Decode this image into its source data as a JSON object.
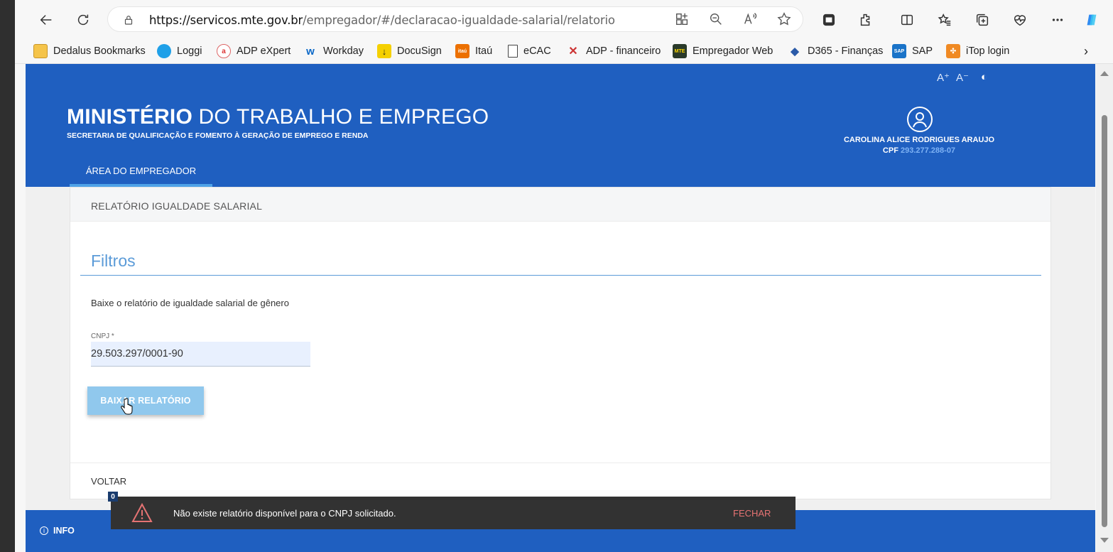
{
  "browser": {
    "url_host": "https://servicos.mte.gov.br",
    "url_path": "/empregador/#/declaracao-igualdade-salarial/relatorio",
    "bookmarks": [
      {
        "label": "Dedalus Bookmarks",
        "icon": "folder-icon"
      },
      {
        "label": "Loggi",
        "icon": "loggi-icon"
      },
      {
        "label": "ADP eXpert",
        "icon": "adp-icon"
      },
      {
        "label": "Workday",
        "icon": "workday-icon"
      },
      {
        "label": "DocuSign",
        "icon": "docusign-icon"
      },
      {
        "label": "Itaú",
        "icon": "itau-icon"
      },
      {
        "label": "eCAC",
        "icon": "page-icon"
      },
      {
        "label": "ADP - financeiro",
        "icon": "adp-x-icon"
      },
      {
        "label": "Empregador Web",
        "icon": "mte-icon"
      },
      {
        "label": "D365 - Finanças",
        "icon": "d365-icon"
      },
      {
        "label": "SAP",
        "icon": "sap-icon"
      },
      {
        "label": "iTop login",
        "icon": "itop-icon"
      }
    ]
  },
  "header": {
    "brand_bold": "MINISTÉRIO",
    "brand_rest": " DO TRABALHO E EMPREGO",
    "subtitle": "SECRETARIA DE QUALIFICAÇÃO E FOMENTO À GERAÇÃO DE EMPREGO E RENDA",
    "a11y": {
      "increase": "A⁺",
      "decrease": "A⁻",
      "contrast": "◐"
    },
    "user_name": "CAROLINA ALICE RODRIGUES ARAUJO",
    "cpf_label": "CPF ",
    "cpf_value": "293.277.288-07",
    "nav_tab": "ÁREA DO EMPREGADOR"
  },
  "card": {
    "title": "RELATÓRIO IGUALDADE SALARIAL",
    "section_title": "Filtros",
    "description": "Baixe o relatório de igualdade salarial de gênero",
    "cnpj_label": "CNPJ *",
    "cnpj_value": "29.503.297/0001-90",
    "download_button": "BAIXAR RELATÓRIO",
    "back_link": "VOLTAR"
  },
  "footer": {
    "info": "INFO"
  },
  "toast": {
    "badge": "0",
    "message": "Não existe relatório disponível para o CNPJ solicitado.",
    "close": "FECHAR"
  },
  "colors": {
    "primary": "#1f5fc0",
    "accent": "#5b9bd8",
    "button": "#90c8ed",
    "toast_bg": "#323232",
    "toast_action": "#e57373"
  }
}
